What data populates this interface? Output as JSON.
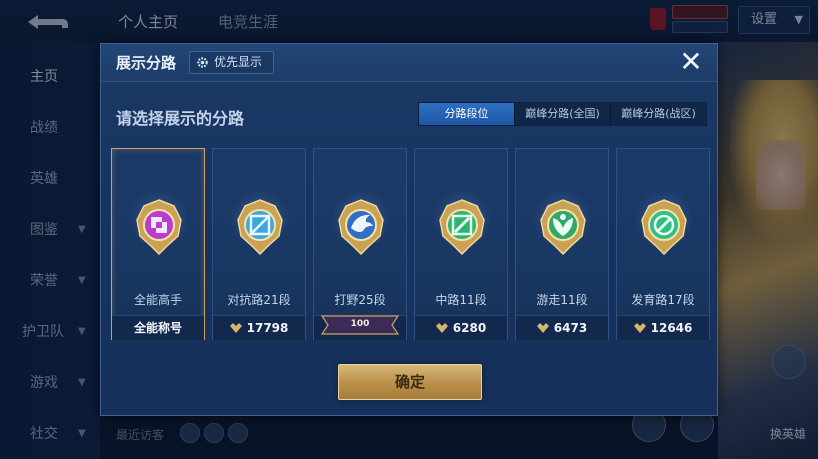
{
  "app": {
    "top_tabs": [
      "个人主页",
      "电竞生涯"
    ],
    "settings_label": "设置",
    "sidebar_items": [
      "主页",
      "战绩",
      "英雄",
      "图鉴",
      "荣誉",
      "护卫队",
      "游戏",
      "社交"
    ],
    "recent_visitors_label": "最近访客",
    "swap_hero_label": "换英雄"
  },
  "dialog": {
    "title": "展示分路",
    "priority_button_label": "优先显示",
    "close_label": "✕",
    "prompt": "请选择展示的分路",
    "tabs": [
      {
        "label": "分路段位",
        "active": true
      },
      {
        "label": "巅峰分路(全国)",
        "active": false
      },
      {
        "label": "巅峰分路(战区)",
        "active": false
      }
    ],
    "cards": [
      {
        "name": "全能高手",
        "footer": "全能称号",
        "selected": true,
        "icon": "all-round-emblem-icon",
        "color": "#b93bd0"
      },
      {
        "name": "对抗路21段",
        "points": "17798",
        "icon": "clash-lane-emblem-icon",
        "color": "#3aa6e0"
      },
      {
        "name": "打野25段",
        "rank_number": "100",
        "icon": "jungle-emblem-icon",
        "color": "#2f6fc7"
      },
      {
        "name": "中路11段",
        "points": "6280",
        "icon": "mid-lane-emblem-icon",
        "color": "#2fb36e"
      },
      {
        "name": "游走11段",
        "points": "6473",
        "icon": "roam-emblem-icon",
        "color": "#2fa86a"
      },
      {
        "name": "发育路17段",
        "points": "12646",
        "icon": "farm-lane-emblem-icon",
        "color": "#2fbf85"
      }
    ],
    "confirm_label": "确定"
  }
}
